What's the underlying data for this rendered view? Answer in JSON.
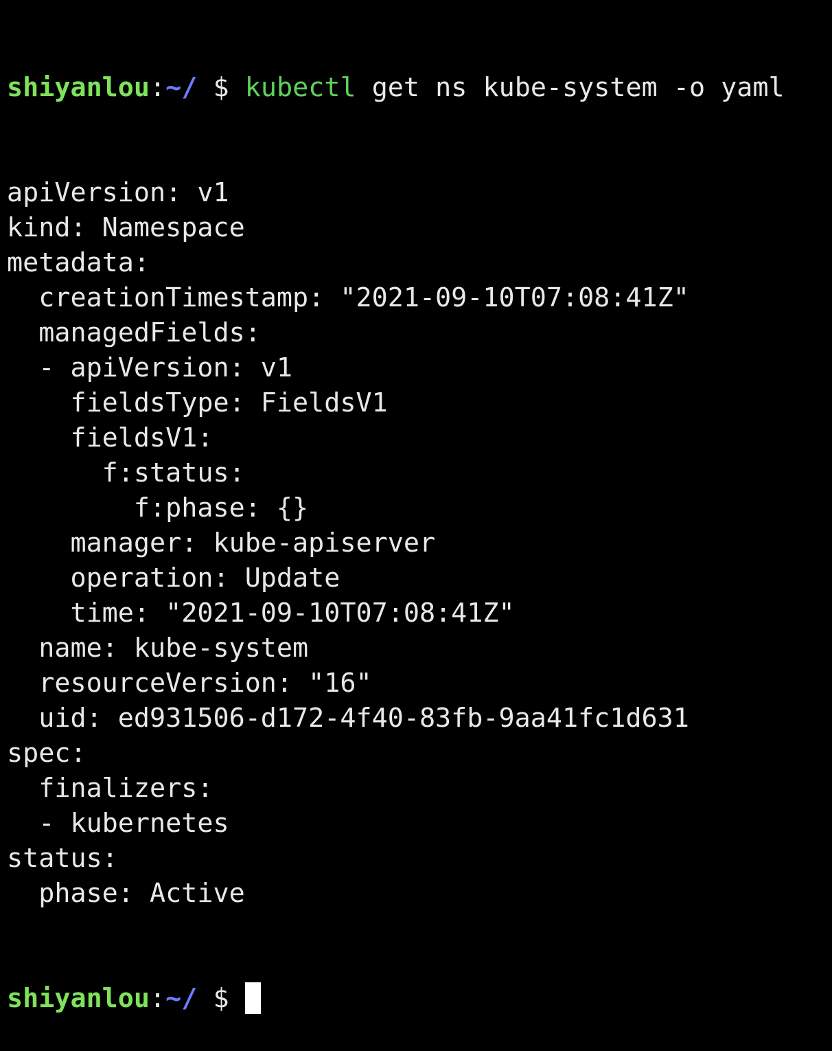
{
  "prompt": {
    "user": "shiyanlou",
    "separator": ":",
    "path": "~/",
    "symbol": "$"
  },
  "command": {
    "name": "kubectl",
    "args": "get ns kube-system -o yaml"
  },
  "output": [
    "apiVersion: v1",
    "kind: Namespace",
    "metadata:",
    "  creationTimestamp: \"2021-09-10T07:08:41Z\"",
    "  managedFields:",
    "  - apiVersion: v1",
    "    fieldsType: FieldsV1",
    "    fieldsV1:",
    "      f:status:",
    "        f:phase: {}",
    "    manager: kube-apiserver",
    "    operation: Update",
    "    time: \"2021-09-10T07:08:41Z\"",
    "  name: kube-system",
    "  resourceVersion: \"16\"",
    "  uid: ed931506-d172-4f40-83fb-9aa41fc1d631",
    "spec:",
    "  finalizers:",
    "  - kubernetes",
    "status:",
    "  phase: Active"
  ],
  "colors": {
    "background": "#000000",
    "text": "#e8e8e8",
    "user": "#7ee35a",
    "path": "#6c7cff",
    "command": "#5ed15e",
    "cursor": "#ffffff"
  }
}
